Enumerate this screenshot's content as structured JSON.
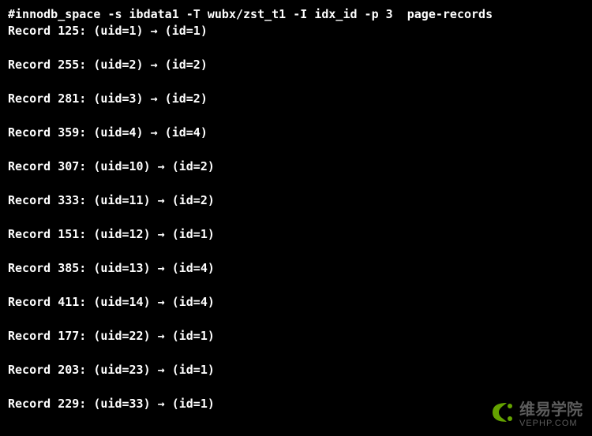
{
  "command": {
    "prompt": "#",
    "tool": "innodb_space",
    "args": "-s ibdata1 -T wubx/zst_t1 -I idx_id -p 3  page-records"
  },
  "arrow": "→",
  "records": [
    {
      "offset": "125",
      "uid": "1",
      "id": "1"
    },
    {
      "offset": "255",
      "uid": "2",
      "id": "2"
    },
    {
      "offset": "281",
      "uid": "3",
      "id": "2"
    },
    {
      "offset": "359",
      "uid": "4",
      "id": "4"
    },
    {
      "offset": "307",
      "uid": "10",
      "id": "2"
    },
    {
      "offset": "333",
      "uid": "11",
      "id": "2"
    },
    {
      "offset": "151",
      "uid": "12",
      "id": "1"
    },
    {
      "offset": "385",
      "uid": "13",
      "id": "4"
    },
    {
      "offset": "411",
      "uid": "14",
      "id": "4"
    },
    {
      "offset": "177",
      "uid": "22",
      "id": "1"
    },
    {
      "offset": "203",
      "uid": "23",
      "id": "1"
    },
    {
      "offset": "229",
      "uid": "33",
      "id": "1"
    }
  ],
  "watermark": {
    "title": "维易学院",
    "url": "VEPHP.COM"
  }
}
